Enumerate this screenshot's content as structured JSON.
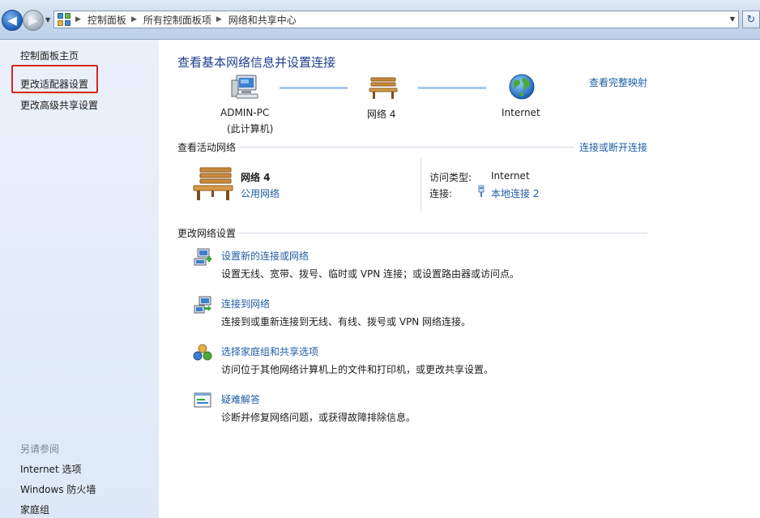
{
  "breadcrumb": {
    "items": [
      "控制面板",
      "所有控制面板项",
      "网络和共享中心"
    ]
  },
  "sidebar": {
    "links": [
      {
        "label": "控制面板主页"
      },
      {
        "label": "更改适配器设置",
        "highlighted": true
      },
      {
        "label": "更改高级共享设置"
      }
    ],
    "see_also_title": "另请参阅",
    "see_also": [
      {
        "label": "Internet 选项"
      },
      {
        "label": "Windows 防火墙"
      },
      {
        "label": "家庭组"
      }
    ]
  },
  "main": {
    "title": "查看基本网络信息并设置连接",
    "full_map_link": "查看完整映射",
    "network_map": {
      "computer": {
        "name": "ADMIN-PC",
        "sub": "(此计算机)",
        "icon": "computer-icon"
      },
      "network": {
        "name": "网络  4",
        "icon": "bench-icon"
      },
      "internet": {
        "name": "Internet",
        "icon": "globe-icon"
      }
    },
    "active_networks": {
      "title": "查看活动网络",
      "action_link": "连接或断开连接",
      "network_name": "网络  4",
      "network_type": "公用网络",
      "access_type_label": "访问类型:",
      "access_type_value": "Internet",
      "connections_label": "连接:",
      "connections_value": "本地连接 2"
    },
    "change_settings": {
      "title": "更改网络设置",
      "tasks": [
        {
          "title": "设置新的连接或网络",
          "desc": "设置无线、宽带、拨号、临时或 VPN 连接；或设置路由器或访问点。",
          "icon": "new-connection-icon"
        },
        {
          "title": "连接到网络",
          "desc": "连接到或重新连接到无线、有线、拨号或 VPN 网络连接。",
          "icon": "connect-network-icon"
        },
        {
          "title": "选择家庭组和共享选项",
          "desc": "访问位于其他网络计算机上的文件和打印机，或更改共享设置。",
          "icon": "homegroup-icon"
        },
        {
          "title": "疑难解答",
          "desc": "诊断并修复网络问题，或获得故障排除信息。",
          "icon": "troubleshoot-icon"
        }
      ]
    }
  },
  "colors": {
    "link": "#1e5ea8",
    "title": "#1e3f8a",
    "highlight_box": "#d9261c",
    "sidebar_bg": "#e4edf9"
  }
}
